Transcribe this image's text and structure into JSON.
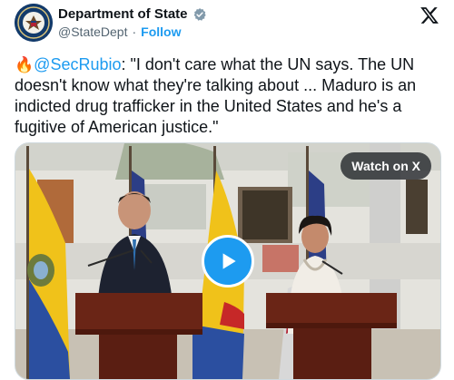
{
  "account": {
    "display_name": "Department of State",
    "handle": "@StateDept",
    "separator": "·",
    "follow_label": "Follow",
    "verified_icon": "verified-badge-icon",
    "avatar_icon": "state-department-seal-icon"
  },
  "platform": {
    "logo_icon": "x-logo-icon"
  },
  "post": {
    "emoji": "🔥",
    "mention": "@SecRubio",
    "text": ": \"I don't care what the UN says. The UN doesn't know what they're talking about ... Maduro is an indicted drug trafficker in the United States and he's a fugitive of American justice.\""
  },
  "media": {
    "watch_label": "Watch on X",
    "play_icon": "play-icon"
  },
  "colors": {
    "accent": "#1d9bf0",
    "text": "#0f1419",
    "secondary_text": "#536471",
    "verified_badge": "#829aab"
  }
}
